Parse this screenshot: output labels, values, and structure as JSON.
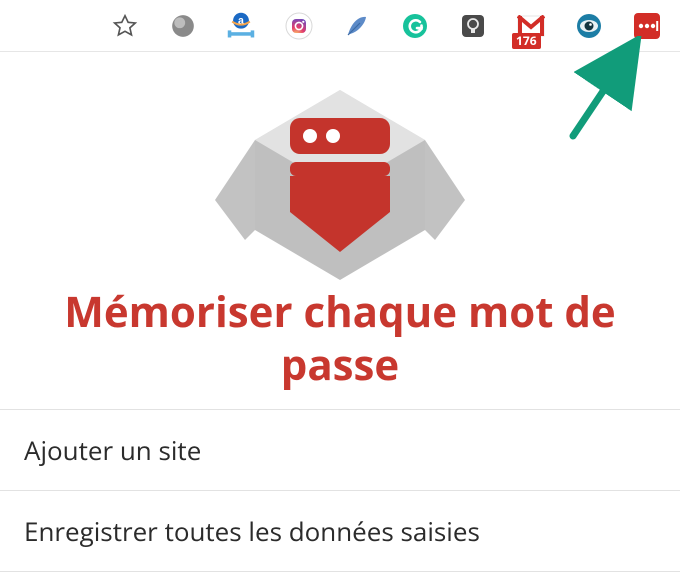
{
  "toolbar": {
    "badge_count": "176",
    "icons": {
      "star": "star-icon",
      "sphere": "sphere-icon",
      "amazon": "amazon-icon",
      "instagram": "instagram-icon",
      "feather": "feather-icon",
      "grammarly": "grammarly-icon",
      "idea": "idea-icon",
      "gmail": "gmail-icon",
      "eye": "eye-icon",
      "lastpass": "lastpass-icon"
    }
  },
  "hero": {
    "title": "Mémoriser chaque mot de passe"
  },
  "menu": {
    "items": [
      {
        "label": "Ajouter un site"
      },
      {
        "label": "Enregistrer toutes les données saisies"
      }
    ]
  }
}
